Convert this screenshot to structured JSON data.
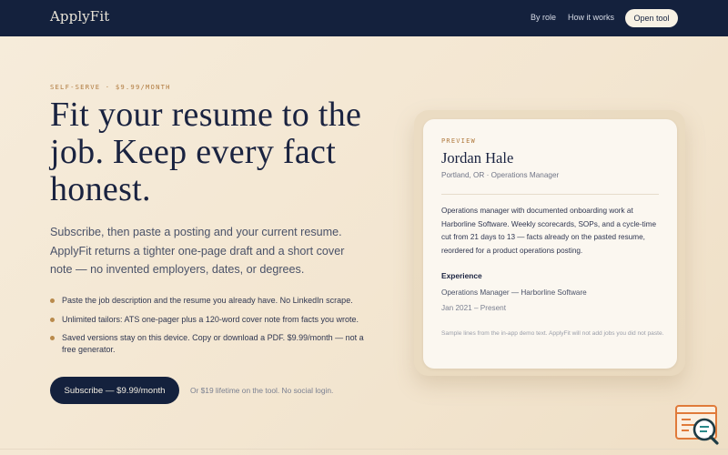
{
  "nav": {
    "brand": "ApplyFit",
    "links": [
      "By role",
      "How it works"
    ],
    "cta": "Open tool"
  },
  "hero": {
    "eyebrow": "SELF-SERVE · $9.99/MONTH",
    "headline": "Fit your resume to the job. Keep every fact honest.",
    "subtext": "Subscribe, then paste a posting and your current resume. ApplyFit returns a tighter one-page draft and a short cover note — no invented employers, dates, or degrees.",
    "bullets": [
      "Paste the job description and the resume you already have. No LinkedIn scrape.",
      "Unlimited tailors: ATS one-pager plus a 120-word cover note from facts you wrote.",
      "Saved versions stay on this device. Copy or download a PDF. $9.99/month — not a free generator."
    ],
    "subscribe_label": "Subscribe — $9.99/month",
    "lifetime_note": "Or $19 lifetime on the tool. No social login."
  },
  "preview": {
    "label": "PREVIEW",
    "name": "Jordan Hale",
    "location": "Portland, OR · Operations Manager",
    "summary": "Operations manager with documented onboarding work at Harborline Software. Weekly scorecards, SOPs, and a cycle-time cut from 21 days to 13 — facts already on the pasted resume, reordered for a product operations posting.",
    "experience_heading": "Experience",
    "role": "Operations Manager — Harborline Software",
    "dates": "Jan 2021 – Present",
    "note": "Sample lines from the in-app demo text. ApplyFit will not add jobs you did not paste."
  },
  "icons": {
    "corner": "document-search-icon"
  },
  "colors": {
    "nav_bg": "#14213d",
    "accent": "#b07a3e",
    "page_bg": "#f4e8d4"
  }
}
